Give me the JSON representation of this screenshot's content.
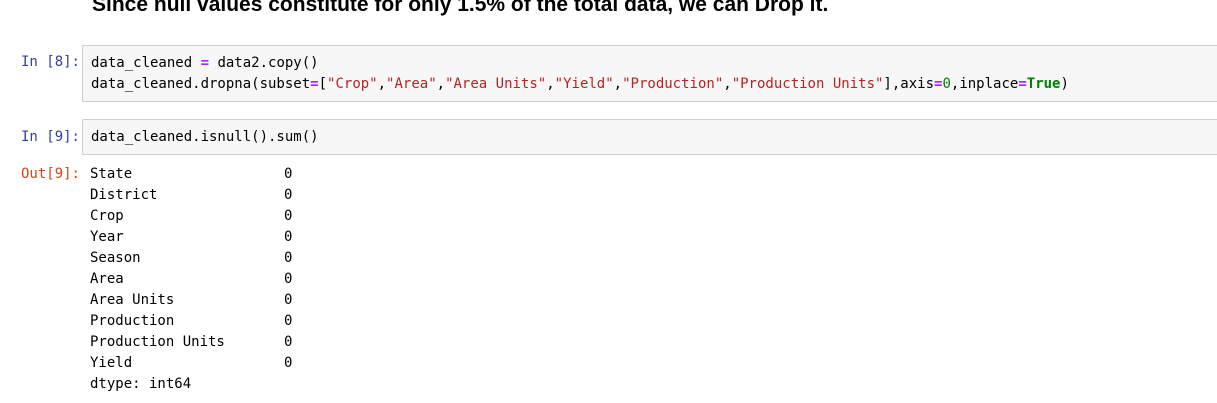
{
  "markdown": {
    "heading": "Since null values constitute for only 1.5% of the total data, we can Drop it."
  },
  "cells": [
    {
      "prompt": "In [8]:",
      "code": {
        "line1": {
          "var": "data_cleaned ",
          "op": "=",
          "rest": " data2.copy()"
        },
        "line2": {
          "call_start": "data_cleaned.dropna(subset",
          "eq1": "=",
          "bracket_open": "[",
          "strings": [
            "\"Crop\"",
            "\"Area\"",
            "\"Area Units\"",
            "\"Yield\"",
            "\"Production\"",
            "\"Production Units\""
          ],
          "comma": ",",
          "bracket_close": "]",
          "axis": ",axis",
          "eq2": "=",
          "axis_value": "0",
          "inplace": ",inplace",
          "eq3": "=",
          "inplace_value": "True",
          "close": ")"
        }
      }
    },
    {
      "prompt": "In [9]:",
      "code_text": "data_cleaned.isnull().sum()",
      "output_prompt": "Out[9]:",
      "output_rows": [
        {
          "name": "State",
          "value": "0"
        },
        {
          "name": "District",
          "value": "0"
        },
        {
          "name": "Crop",
          "value": "0"
        },
        {
          "name": "Year",
          "value": "0"
        },
        {
          "name": "Season",
          "value": "0"
        },
        {
          "name": "Area",
          "value": "0"
        },
        {
          "name": "Area Units",
          "value": "0"
        },
        {
          "name": "Production",
          "value": "0"
        },
        {
          "name": "Production Units",
          "value": "0"
        },
        {
          "name": "Yield",
          "value": "0"
        }
      ],
      "dtype_line": "dtype: int64"
    }
  ]
}
